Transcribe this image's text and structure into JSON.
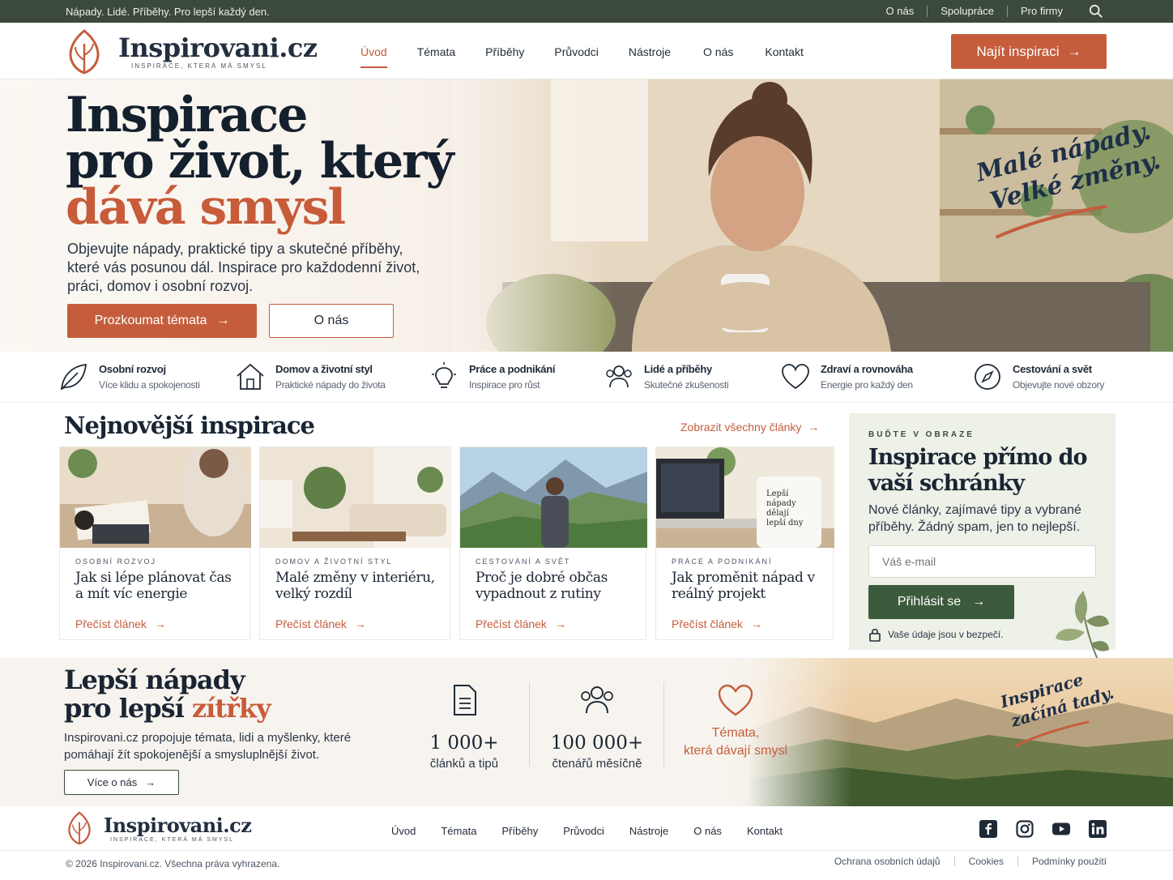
{
  "topbar": {
    "tagline": "Nápady. Lidé. Příběhy. Pro lepší každý den.",
    "links": [
      "O nás",
      "Spolupráce",
      "Pro firmy"
    ],
    "search_icon": "search-icon"
  },
  "header": {
    "logo_name": "Inspirovani.cz",
    "logo_tagline": "INSPIRACE, KTERÁ MÁ SMYSL",
    "nav": [
      "Úvod",
      "Témata",
      "Příběhy",
      "Průvodci",
      "Nástroje",
      "O nás",
      "Kontakt"
    ],
    "active_nav": "Úvod",
    "cta_label": "Najít inspiraci"
  },
  "hero": {
    "title_line1": "Inspirace",
    "title_line2": "pro život, který",
    "title_accent": "dává smysl",
    "lead": "Objevujte nápady, praktické tipy a skutečné příběhy, které vás posunou dál. Inspirace pro každodenní život, práci, domov i osobní rozvoj.",
    "primary_button": "Prozkoumat témata",
    "secondary_button": "O nás",
    "handwritten_line1": "Malé nápady.",
    "handwritten_line2": "Velké změny."
  },
  "categories": [
    {
      "title": "Osobní rozvoj",
      "subtitle": "Více klidu a spokojenosti",
      "icon": "leaf-icon"
    },
    {
      "title": "Domov a životní styl",
      "subtitle": "Praktické nápady do života",
      "icon": "house-icon"
    },
    {
      "title": "Práce a podnikání",
      "subtitle": "Inspirace pro růst",
      "icon": "lightbulb-icon"
    },
    {
      "title": "Lidé a příběhy",
      "subtitle": "Skutečné zkušenosti",
      "icon": "people-icon"
    },
    {
      "title": "Zdraví a rovnováha",
      "subtitle": "Energie pro každý den",
      "icon": "heart-icon"
    },
    {
      "title": "Cestování a svět",
      "subtitle": "Objevujte nové obzory",
      "icon": "compass-icon"
    }
  ],
  "latest": {
    "title": "Nejnovější inspirace",
    "see_all": "Zobrazit všechny články",
    "read_label": "Přečíst článek",
    "articles": [
      {
        "kicker": "OSOBNÍ ROZVOJ",
        "title": "Jak si lépe plánovat čas a mít víc energie"
      },
      {
        "kicker": "DOMOV A ŽIVOTNÍ STYL",
        "title": "Malé změny v interiéru, velký rozdíl"
      },
      {
        "kicker": "CESTOVÁNÍ A SVĚT",
        "title": "Proč je dobré občas vypadnout z rutiny"
      },
      {
        "kicker": "PRÁCE A PODNIKÁNÍ",
        "title": "Jak proměnit nápad v reálný projekt"
      }
    ],
    "mug_text": "Lepší nápady dělají lepší dny"
  },
  "newsletter": {
    "kicker": "BUĎTE V OBRAZE",
    "title": "Inspirace přímo do vaší schránky",
    "text": "Nové články, zajímavé tipy a vybrané příběhy. Žádný spam, jen to nejlepší.",
    "email_placeholder": "Váš e-mail",
    "submit": "Přihlásit se",
    "safe_note": "Vaše údaje jsou v bezpečí."
  },
  "band": {
    "title_line1": "Lepší nápady",
    "title_line2": "pro lepší",
    "title_accent": "zítřky",
    "text": "Inspirovani.cz propojuje témata, lidi a myšlenky, které pomáhají žít spokojenější a smysluplnější život.",
    "more_button": "Více o nás",
    "stats": [
      {
        "value": "1 000+",
        "label": "článků a tipů",
        "icon": "document-icon"
      },
      {
        "value": "100 000+",
        "label": "čtenářů měsíčně",
        "icon": "people-icon"
      },
      {
        "value": "Témata,",
        "label": "která dávají smysl",
        "icon": "heart-icon"
      }
    ],
    "handwritten_line1": "Inspirace",
    "handwritten_line2": "začíná tady."
  },
  "footer": {
    "logo_name": "Inspirovani.cz",
    "logo_tagline": "INSPIRACE, KTERÁ MÁ SMYSL",
    "nav": [
      "Úvod",
      "Témata",
      "Příběhy",
      "Průvodci",
      "Nástroje",
      "O nás",
      "Kontakt"
    ],
    "social": [
      "facebook-icon",
      "instagram-icon",
      "youtube-icon",
      "linkedin-icon"
    ],
    "copyright": "© 2026 Inspirovani.cz. Všechna práva vyhrazena.",
    "legal": [
      "Ochrana osobních údajů",
      "Cookies",
      "Podmínky použití"
    ]
  },
  "colors": {
    "accent": "#c55d3c",
    "dark_green": "#3b4a3b",
    "navy": "#1a2533",
    "sage": "#eef1e8"
  }
}
